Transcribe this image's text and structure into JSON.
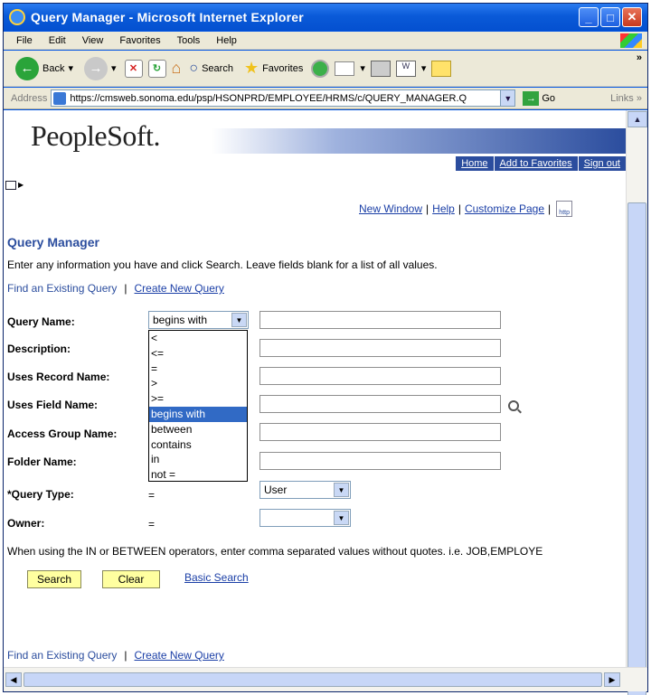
{
  "window": {
    "title": "Query Manager - Microsoft Internet Explorer"
  },
  "menu": [
    "File",
    "Edit",
    "View",
    "Favorites",
    "Tools",
    "Help"
  ],
  "toolbar": {
    "back": "Back",
    "search": "Search",
    "favorites": "Favorites"
  },
  "address": {
    "label": "Address",
    "url": "https://cmsweb.sonoma.edu/psp/HSONPRD/EMPLOYEE/HRMS/c/QUERY_MANAGER.Q",
    "go": "Go",
    "links": "Links"
  },
  "header": {
    "logo": "PeopleSoft.",
    "home": "Home",
    "add_favorites": "Add to Favorites",
    "sign_out": "Sign out"
  },
  "pagelinks": {
    "new_window": "New Window",
    "help": "Help",
    "customize": "Customize Page",
    "http": "http"
  },
  "page": {
    "title": "Query Manager",
    "instructions": "Enter any information you have and click Search. Leave fields blank for a list of all values.",
    "find_existing": "Find an Existing Query",
    "sep": "|",
    "create_new": "Create New Query",
    "note": "When using the IN or BETWEEN operators, enter comma separated values without quotes. i.e. JOB,EMPLOYE"
  },
  "fields": {
    "query_name": "Query Name:",
    "description": "Description:",
    "uses_record": "Uses Record Name:",
    "uses_field": "Uses Field Name:",
    "access_group": "Access Group Name:",
    "folder_name": "Folder Name:",
    "query_type": "*Query Type:",
    "owner": "Owner:"
  },
  "operator": {
    "selected": "begins with",
    "eq": "=",
    "options": [
      "<",
      "<=",
      "=",
      ">",
      ">=",
      "begins with",
      "between",
      "contains",
      "in",
      "not ="
    ]
  },
  "query_type_value": "User",
  "owner_value": "",
  "buttons": {
    "search": "Search",
    "clear": "Clear",
    "basic_search": "Basic Search"
  }
}
